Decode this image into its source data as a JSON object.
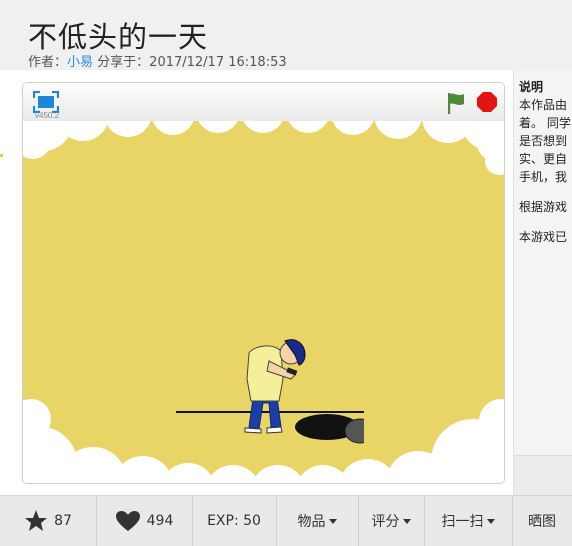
{
  "header": {
    "title": "不低头的一天",
    "author_prefix": "作者：",
    "author": "小易",
    "shared_prefix": " 分享于：",
    "shared_time": "2017/12/17 16:18:53"
  },
  "player": {
    "version": "v450.2",
    "fullscreen_icon": "fullscreen-icon",
    "flag_icon": "green-flag-icon",
    "stop_icon": "stop-icon",
    "colors": {
      "stage_bg": "#e8d566",
      "cloud": "#ffffff",
      "flag": "#4f8a3c",
      "stop": "#e41414"
    }
  },
  "description": {
    "heading": "说明",
    "lines": [
      "本作品由",
      "着。 同学",
      "是否想到",
      "实、更自",
      "手机，我"
    ],
    "line2": "根据游戏",
    "line3": "本游戏已"
  },
  "bottom_bar": {
    "stars": "87",
    "likes": "494",
    "exp": "EXP: 50",
    "items": "物品",
    "rating": "评分",
    "scan": "扫一扫",
    "share": "晒图"
  }
}
